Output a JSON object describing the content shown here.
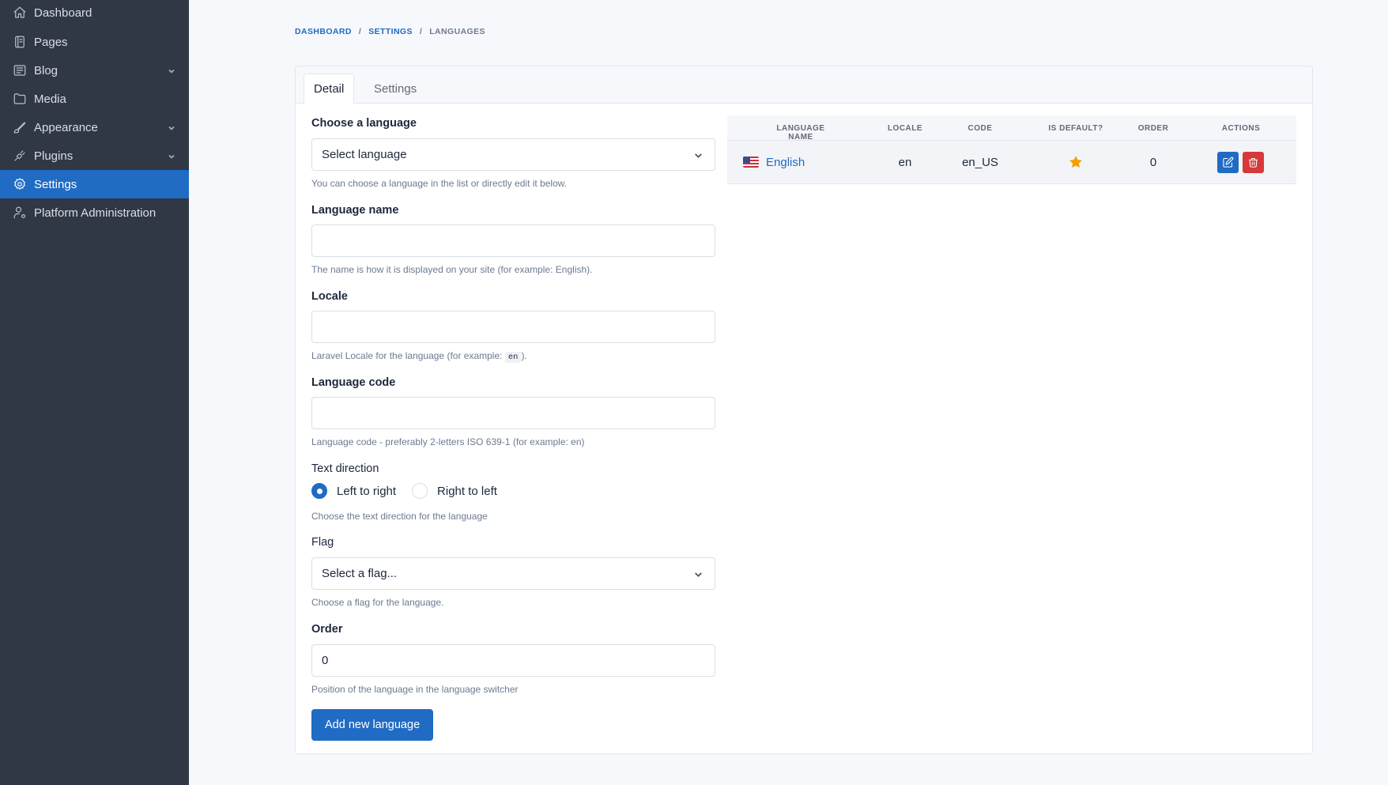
{
  "colors": {
    "sidebar_bg": "#303846",
    "primary": "#206bc4",
    "danger": "#d63939",
    "star": "#f59f00"
  },
  "sidebar": {
    "items": [
      {
        "label": "Dashboard",
        "icon": "home-icon"
      },
      {
        "label": "Pages",
        "icon": "pages-icon"
      },
      {
        "label": "Blog",
        "icon": "blog-icon",
        "has_submenu": true
      },
      {
        "label": "Media",
        "icon": "folder-icon"
      },
      {
        "label": "Appearance",
        "icon": "brush-icon",
        "has_submenu": true
      },
      {
        "label": "Plugins",
        "icon": "plug-icon",
        "has_submenu": true
      },
      {
        "label": "Settings",
        "icon": "gear-icon",
        "active": true
      },
      {
        "label": "Platform Administration",
        "icon": "user-cog-icon"
      }
    ]
  },
  "breadcrumb": {
    "items": [
      "DASHBOARD",
      "SETTINGS",
      "LANGUAGES"
    ],
    "separator": "/"
  },
  "tabs": [
    {
      "label": "Detail",
      "active": true
    },
    {
      "label": "Settings",
      "active": false
    }
  ],
  "form": {
    "choose_language": {
      "label": "Choose a language",
      "value": "Select language",
      "hint": "You can choose a language in the list or directly edit it below."
    },
    "language_name": {
      "label": "Language name",
      "value": "",
      "hint": "The name is how it is displayed on your site (for example: English)."
    },
    "locale": {
      "label": "Locale",
      "value": "",
      "hint_before": "Laravel Locale for the language (for example:",
      "hint_code": "en",
      "hint_after": ")."
    },
    "language_code": {
      "label": "Language code",
      "value": "",
      "hint": "Language code - preferably 2-letters ISO 639-1 (for example: en)"
    },
    "text_direction": {
      "label": "Text direction",
      "options": [
        {
          "label": "Left to right",
          "checked": true
        },
        {
          "label": "Right to left",
          "checked": false
        }
      ],
      "hint": "Choose the text direction for the language"
    },
    "flag": {
      "label": "Flag",
      "value": "Select a flag...",
      "hint": "Choose a flag for the language."
    },
    "order": {
      "label": "Order",
      "value": "0",
      "hint": "Position of the language in the language switcher"
    },
    "submit_label": "Add new language"
  },
  "table": {
    "columns": [
      "LANGUAGE NAME",
      "LOCALE",
      "CODE",
      "IS DEFAULT?",
      "ORDER",
      "ACTIONS"
    ],
    "rows": [
      {
        "name": "English",
        "flag_icon": "us-flag-icon",
        "locale": "en",
        "code": "en_US",
        "is_default": true,
        "order": "0"
      }
    ]
  }
}
